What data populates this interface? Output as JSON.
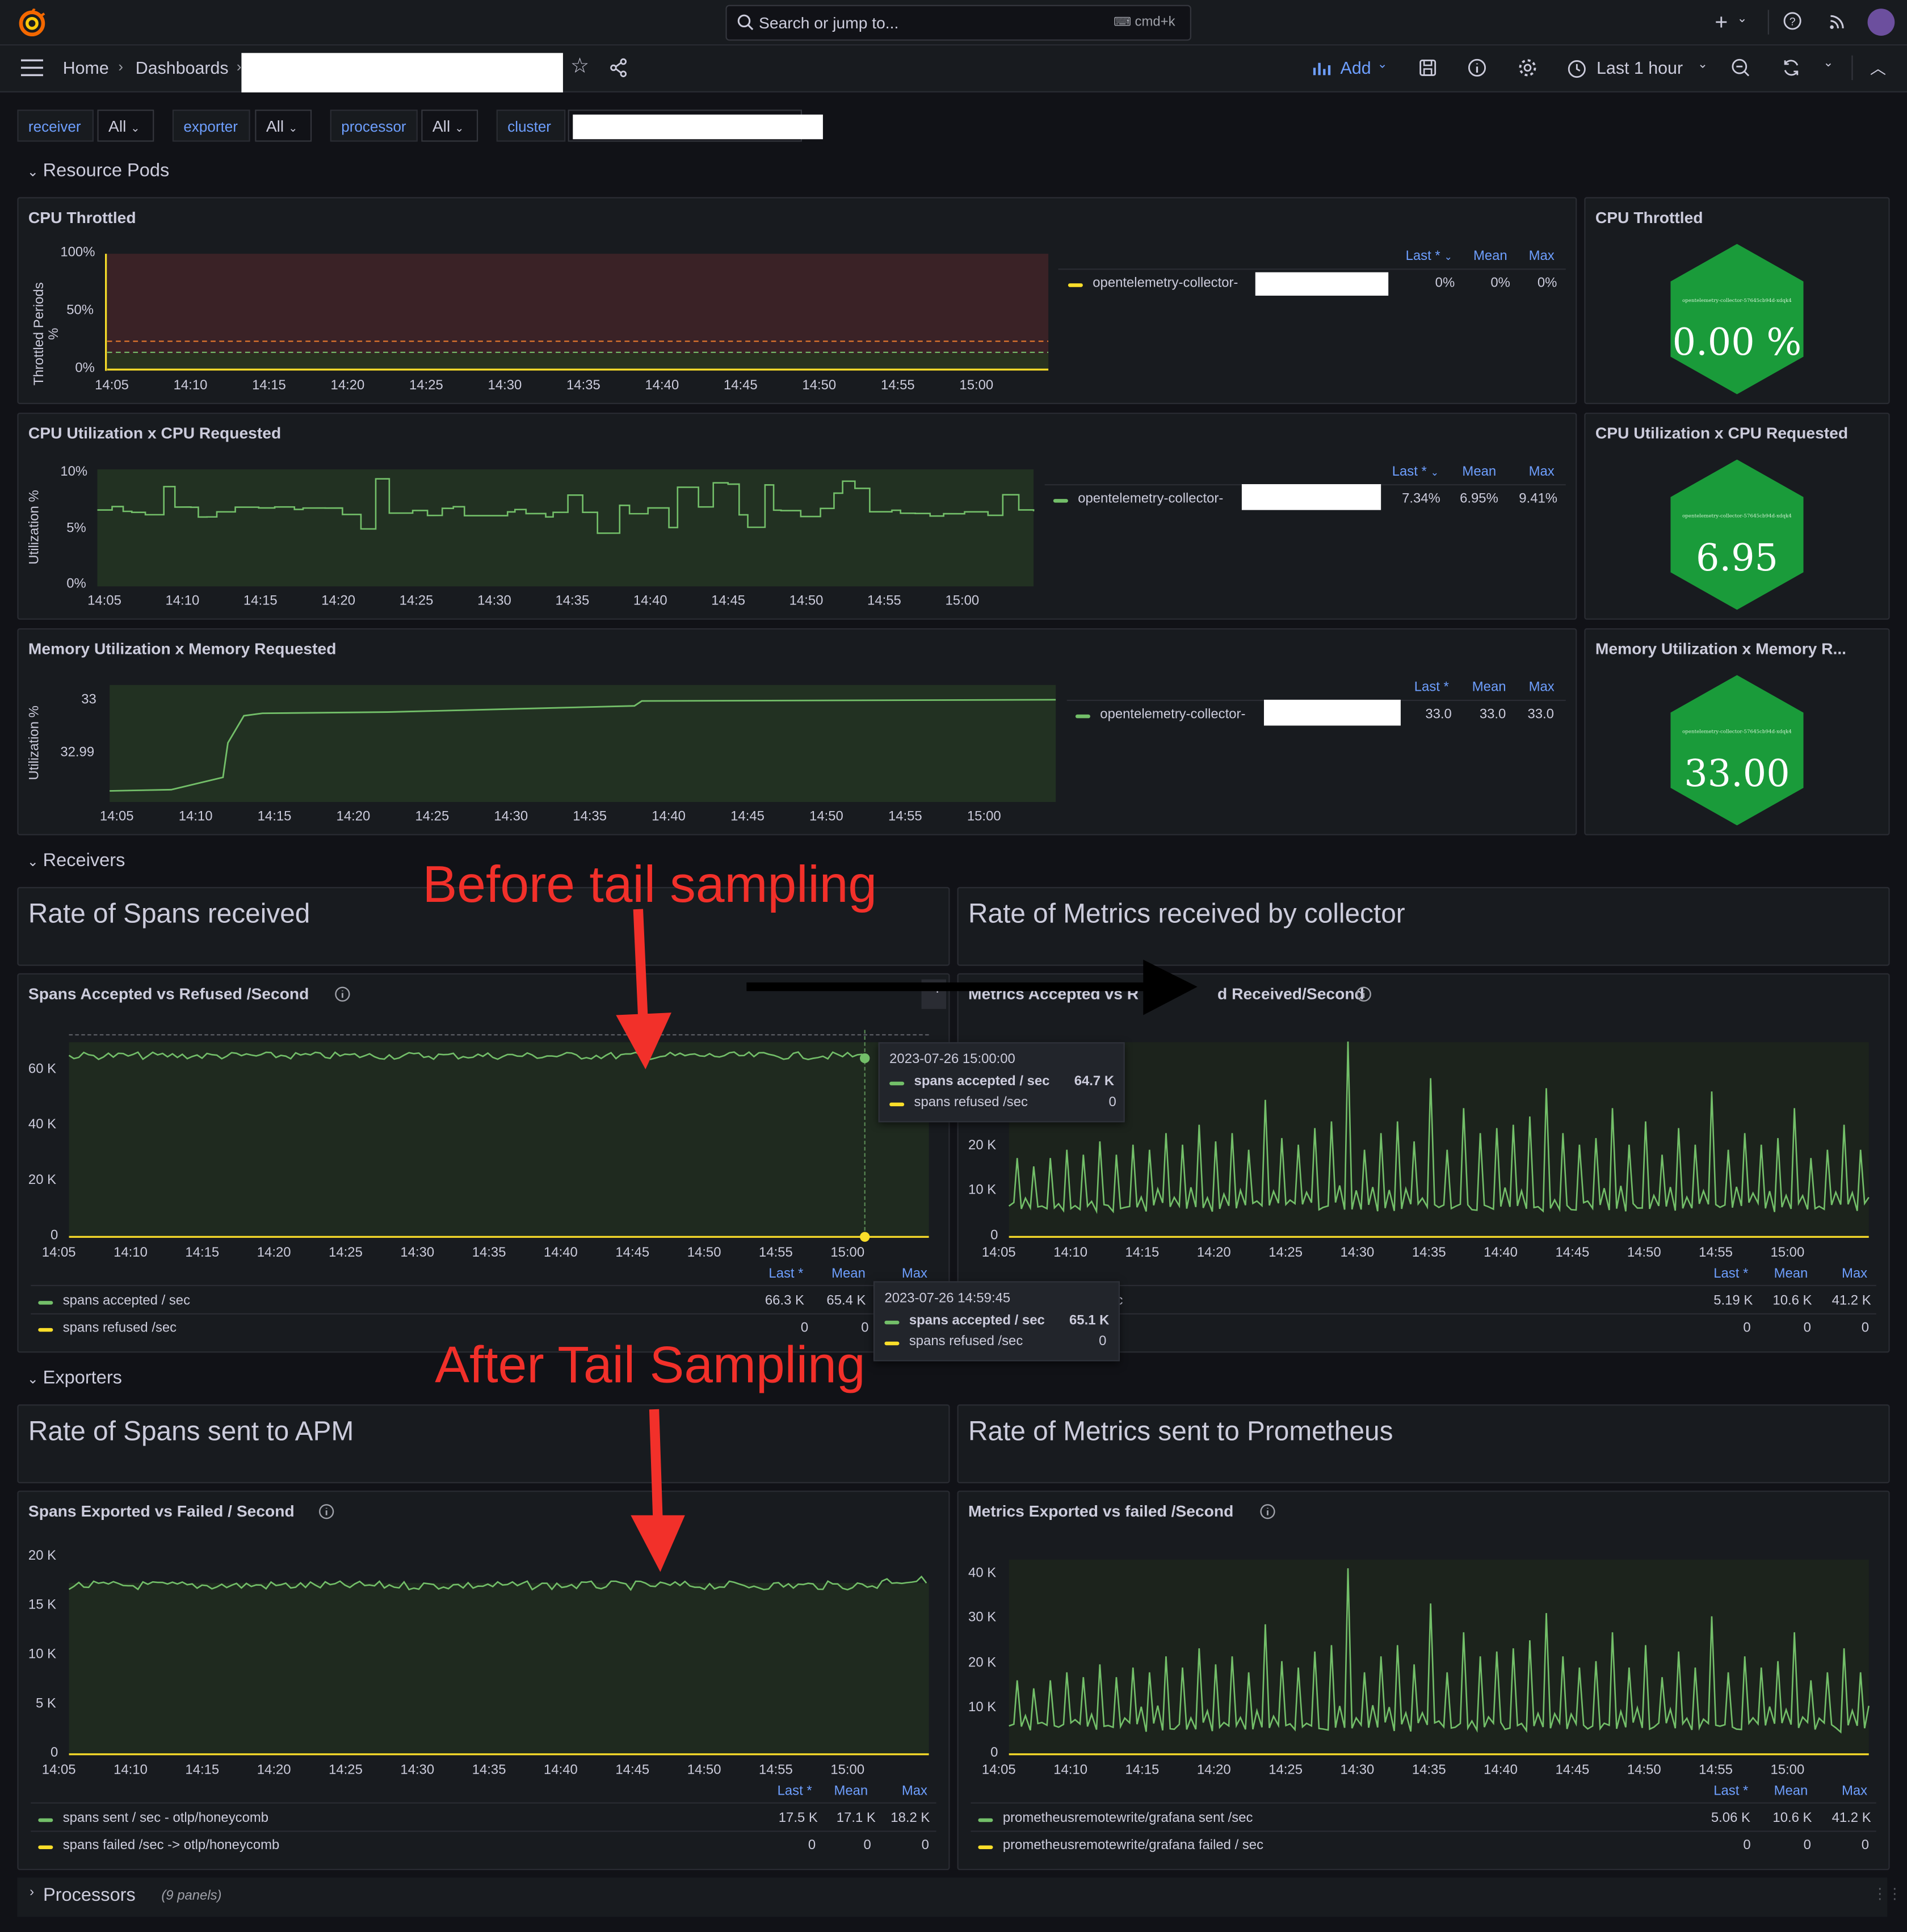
{
  "topbar": {
    "search_placeholder": "Search or jump to...",
    "shortcut": "cmd+k"
  },
  "nav": {
    "home": "Home",
    "dashboards": "Dashboards",
    "add": "Add",
    "time_range": "Last 1 hour"
  },
  "variables": [
    {
      "name": "receiver",
      "value": "All"
    },
    {
      "name": "exporter",
      "value": "All"
    },
    {
      "name": "processor",
      "value": "All"
    },
    {
      "name": "cluster",
      "value": ""
    }
  ],
  "rows": {
    "resource_pods": "Resource Pods",
    "receivers": "Receivers",
    "exporters": "Exporters",
    "processors": "Processors",
    "processors_count": "(9 panels)"
  },
  "time_ticks": [
    "14:05",
    "14:10",
    "14:15",
    "14:20",
    "14:25",
    "14:30",
    "14:35",
    "14:40",
    "14:45",
    "14:50",
    "14:55",
    "15:00"
  ],
  "legend_series_prefix": "opentelemetry-collector-",
  "legend_headers": {
    "last": "Last *",
    "mean": "Mean",
    "max": "Max"
  },
  "cpu_throttled": {
    "title": "CPU Throttled",
    "ylabel": "Throttled Periods %",
    "yticks": [
      "100%",
      "50%",
      "0%"
    ],
    "last": "0%",
    "mean": "0%",
    "max": "0%",
    "stat_title": "CPU Throttled",
    "stat_value": "0.00 %",
    "stat_caption": "opentelemetry-collector-57645cb94d-xdqk4"
  },
  "cpu_util": {
    "title": "CPU Utilization x CPU Requested",
    "ylabel": "Utilization %",
    "yticks": [
      "10%",
      "5%",
      "0%"
    ],
    "last": "7.34%",
    "mean": "6.95%",
    "max": "9.41%",
    "stat_title": "CPU Utilization x CPU Requested",
    "stat_value": "6.95",
    "stat_caption": "opentelemetry-collector-57645cb94d-xdqk4"
  },
  "mem_util": {
    "title": "Memory Utilization x Memory Requested",
    "ylabel": "Utilization %",
    "yticks": [
      "33",
      "32.99"
    ],
    "last": "33.0",
    "mean": "33.0",
    "max": "33.0",
    "stat_title": "Memory Utilization x Memory R...",
    "stat_value": "33.00",
    "stat_caption": "opentelemetry-collector-57645cb94d-xdqk4"
  },
  "receivers": {
    "spans_text": "Rate of Spans received",
    "metrics_text": "Rate of Metrics received by collector",
    "spans_panel_title": "Spans Accepted vs Refused /Second",
    "metrics_panel_title_a": "Metrics Accepted vs R",
    "metrics_panel_title_b": "d Received/Second",
    "spans_yticks": [
      "60 K",
      "40 K",
      "20 K",
      "0"
    ],
    "metrics_yticks": [
      "20 K",
      "10 K",
      "0"
    ],
    "spans_legend": [
      {
        "name": "spans accepted / sec",
        "last": "66.3 K",
        "mean": "65.4 K",
        "color": "#73bf69"
      },
      {
        "name": "spans refused /sec",
        "last": "0",
        "mean": "0",
        "color": "#fade2a"
      }
    ],
    "metrics_legend": [
      {
        "name": "c",
        "last": "5.19 K",
        "mean": "10.6 K",
        "max": "41.2 K"
      },
      {
        "name": "",
        "last": "0",
        "mean": "0",
        "max": "0"
      }
    ],
    "tooltip1": {
      "time": "2023-07-26 15:00:00",
      "accepted": "spans accepted / sec",
      "accepted_val": "64.7 K",
      "refused": "spans refused /sec",
      "refused_val": "0"
    },
    "tooltip2": {
      "time": "2023-07-26 14:59:45",
      "accepted": "spans accepted / sec",
      "accepted_val": "65.1 K",
      "refused": "spans refused /sec",
      "refused_val": "0"
    }
  },
  "exporters": {
    "spans_text": "Rate of Spans sent to APM",
    "metrics_text": "Rate of Metrics sent to Prometheus",
    "spans_panel_title": "Spans Exported vs Failed / Second",
    "metrics_panel_title": "Metrics Exported vs failed /Second",
    "spans_yticks": [
      "20 K",
      "15 K",
      "10 K",
      "5 K",
      "0"
    ],
    "metrics_yticks": [
      "40 K",
      "30 K",
      "20 K",
      "10 K",
      "0"
    ],
    "spans_legend": [
      {
        "name": "spans sent / sec - otlp/honeycomb",
        "last": "17.5 K",
        "mean": "17.1 K",
        "max": "18.2 K",
        "color": "#73bf69"
      },
      {
        "name": "spans failed /sec -> otlp/honeycomb",
        "last": "0",
        "mean": "0",
        "max": "0",
        "color": "#fade2a"
      }
    ],
    "metrics_legend": [
      {
        "name": "prometheusremotewrite/grafana sent /sec",
        "last": "5.06 K",
        "mean": "10.6 K",
        "max": "41.2 K",
        "color": "#73bf69"
      },
      {
        "name": "prometheusremotewrite/grafana failed / sec",
        "last": "0",
        "mean": "0",
        "max": "0",
        "color": "#fade2a"
      }
    ]
  },
  "annotations": {
    "before": "Before tail sampling",
    "after": "After Tail Sampling"
  },
  "colors": {
    "series_green": "#73bf69",
    "series_yellow": "#fade2a",
    "link_blue": "#6e9fff",
    "stat_green": "#1a9b3a",
    "annotation_red": "#f2302a"
  }
}
